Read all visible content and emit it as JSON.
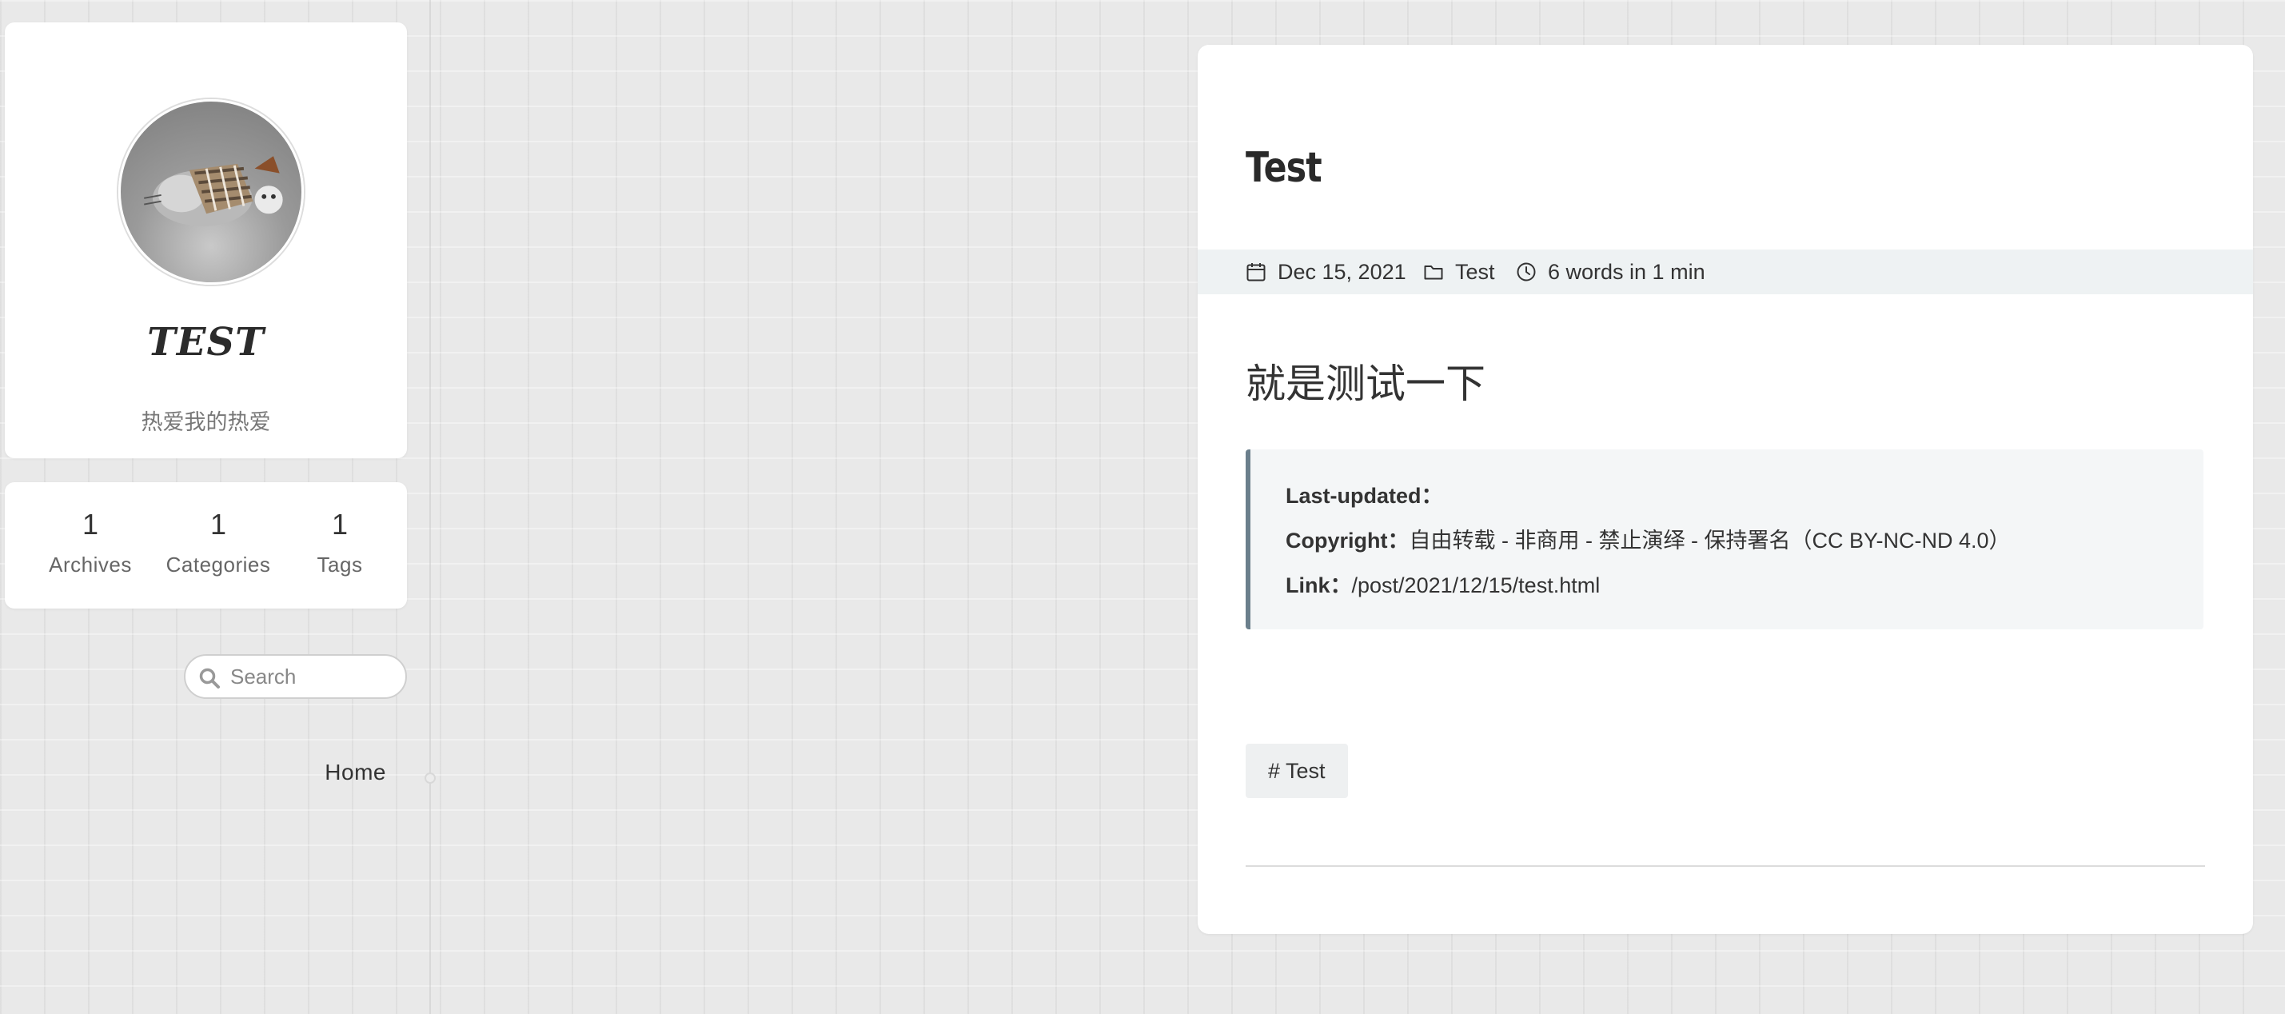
{
  "sidebar": {
    "site_title": "TEST",
    "subtitle": "热爱我的热爱",
    "stats": [
      {
        "count": "1",
        "label": "Archives"
      },
      {
        "count": "1",
        "label": "Categories"
      },
      {
        "count": "1",
        "label": "Tags"
      }
    ],
    "search": {
      "placeholder": "Search",
      "icon": "search-icon"
    },
    "nav": [
      {
        "label": "Home"
      }
    ]
  },
  "post": {
    "title": "Test",
    "meta": {
      "date": "Dec 15, 2021",
      "category": "Test",
      "reading": "6 words in 1 min"
    },
    "body": "就是测试一下",
    "copyright": {
      "last_updated_label": "Last-updated：",
      "last_updated_value": "",
      "copyright_label": "Copyright：",
      "copyright_value": "自由转载 - 非商用 - 禁止演绎 - 保持署名（CC BY-NC-ND 4.0）",
      "link_label": "Link：",
      "link_value": "/post/2021/12/15/test.html"
    },
    "tags": [
      "# Test"
    ]
  },
  "colors": {
    "accent_border": "#6b7f8c",
    "meta_bar": "#eef2f3",
    "card_bg": "#ffffff"
  }
}
